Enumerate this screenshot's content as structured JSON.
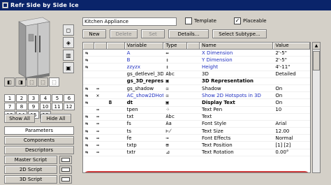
{
  "window": {
    "title": "Refr Side by Side Ice"
  },
  "left": {
    "view_buttons": [
      "◧",
      "◨",
      "⬚",
      "⬚",
      "⬚"
    ],
    "story_numbers": [
      "1",
      "2",
      "3",
      "4",
      "5",
      "6",
      "7",
      "8",
      "9",
      "10",
      "11",
      "12",
      "13",
      "14",
      "15",
      "16"
    ],
    "show_all": "Show All",
    "hide_all": "Hide All",
    "tabs": [
      "Parameters",
      "Components",
      "Descriptors"
    ],
    "scripts": [
      "Master Script",
      "2D Script",
      "3D Script"
    ]
  },
  "right": {
    "description_value": "Kitchen Appliance",
    "template_label": "Template",
    "template_checked": false,
    "placeable_label": "Placeable",
    "placeable_checked": true,
    "toolbar": {
      "new": "New",
      "delete": "Delete",
      "set": "Set",
      "details": "Details...",
      "select_subtype": "Select Subtype..."
    },
    "columns": [
      "Variable",
      "Type",
      "Name",
      "Value"
    ],
    "rows": [
      {
        "c0": "⇆",
        "c1": "",
        "c2": "",
        "var": "A",
        "type": "↔",
        "name": "X Dimension",
        "value": "2'-5\"",
        "varclass": "blue",
        "nameclass": "blue"
      },
      {
        "c0": "⇆",
        "c1": "",
        "c2": "",
        "var": "B",
        "type": "↕",
        "name": "Y Dimension",
        "value": "2'-5\"",
        "varclass": "blue",
        "nameclass": "blue"
      },
      {
        "c0": "⇆",
        "c1": "",
        "c2": "",
        "var": "zzyzx",
        "type": "↕",
        "name": "Height",
        "value": "4'-11\"",
        "varclass": "blue",
        "nameclass": "blue"
      },
      {
        "c0": "",
        "c1": "",
        "c2": "",
        "var": "gs_detlevel_3D",
        "type": "Abc",
        "name": "3D",
        "value": "Detailed",
        "varclass": "",
        "nameclass": ""
      },
      {
        "c0": "",
        "c1": "",
        "c2": "",
        "var": "gs_3D_repres...",
        "type": "▣",
        "name": "3D Representation",
        "value": "",
        "varclass": "bold",
        "nameclass": "bold"
      },
      {
        "c0": "⇆",
        "c1": "⇛",
        "c2": "",
        "var": "gs_shadow",
        "type": "☒",
        "name": "Shadow",
        "value": "On",
        "varclass": "",
        "nameclass": ""
      },
      {
        "c0": "⇆",
        "c1": "✕",
        "c2": "",
        "var": "AC_show2DHots...",
        "type": "☒",
        "name": "Show 2D Hotspots in 3D",
        "value": "On",
        "varclass": "blue",
        "nameclass": "blue"
      },
      {
        "c0": "⇆",
        "c1": "",
        "c2": "B",
        "var": "dt",
        "type": "▣",
        "name": "Display Text",
        "value": "On",
        "varclass": "bold",
        "nameclass": "bold"
      },
      {
        "c0": "",
        "c1": "⇛",
        "c2": "",
        "var": "tpen",
        "type": "⁘",
        "name": "Text Pen",
        "value": "10",
        "varclass": "",
        "nameclass": ""
      },
      {
        "c0": "⇆",
        "c1": "⇛",
        "c2": "",
        "var": "txt",
        "type": "Abc",
        "name": "Text",
        "value": "",
        "varclass": "",
        "nameclass": ""
      },
      {
        "c0": "⇆",
        "c1": "⇛",
        "c2": "",
        "var": "fs",
        "type": "Aa",
        "name": "Font Style",
        "value": "Arial",
        "varclass": "",
        "nameclass": ""
      },
      {
        "c0": "⇆",
        "c1": "⇛",
        "c2": "",
        "var": "ts",
        "type": "⊬",
        "name": "Text Size",
        "value": "12.00",
        "varclass": "",
        "nameclass": ""
      },
      {
        "c0": "⇆",
        "c1": "⇛",
        "c2": "",
        "var": "fe",
        "type": "⊸",
        "name": "Font Effects",
        "value": "Normal",
        "varclass": "",
        "nameclass": ""
      },
      {
        "c0": "⇆",
        "c1": "⇛",
        "c2": "",
        "var": "txtp",
        "type": "⊞",
        "name": "Text Position",
        "value": "[1] [2]",
        "varclass": "",
        "nameclass": ""
      },
      {
        "c0": "⇆",
        "c1": "⇛",
        "c2": "",
        "var": "txtr",
        "type": "⊿",
        "name": "Text Rotation",
        "value": "0.00°",
        "varclass": "",
        "nameclass": ""
      }
    ]
  }
}
